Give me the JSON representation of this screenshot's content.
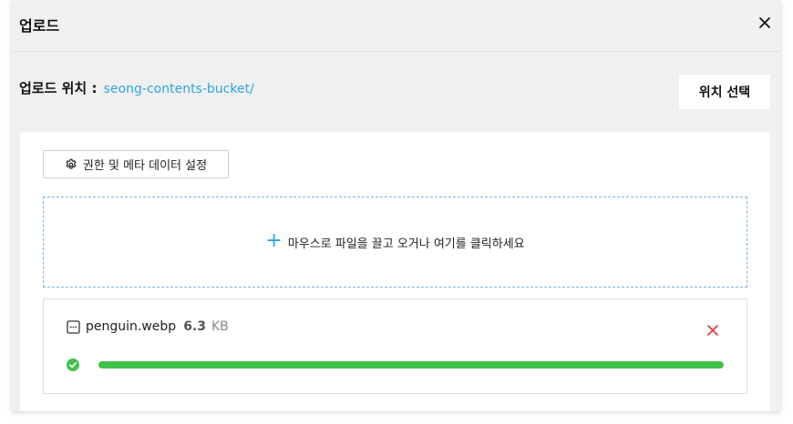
{
  "modal": {
    "title": "업로드"
  },
  "location": {
    "label": "업로드 위치 : ",
    "value": "seong-contents-bucket/",
    "select_button": "위치 선택"
  },
  "settings_button": {
    "label": "권한 및 메타 데이터 설정",
    "icon": "gear-icon"
  },
  "dropzone": {
    "icon": "plus-icon",
    "text": "마우스로 파일을 끌고 오거나 여기를 클릭하세요"
  },
  "files": [
    {
      "name": "penguin.webp",
      "size_value": "6.3",
      "size_unit": "KB",
      "status": "complete",
      "progress_percent": 100
    }
  ],
  "colors": {
    "accent": "#2fa4dd",
    "progress": "#42c14a",
    "remove": "#e0393e",
    "modal_bg": "#f0f0f0"
  }
}
